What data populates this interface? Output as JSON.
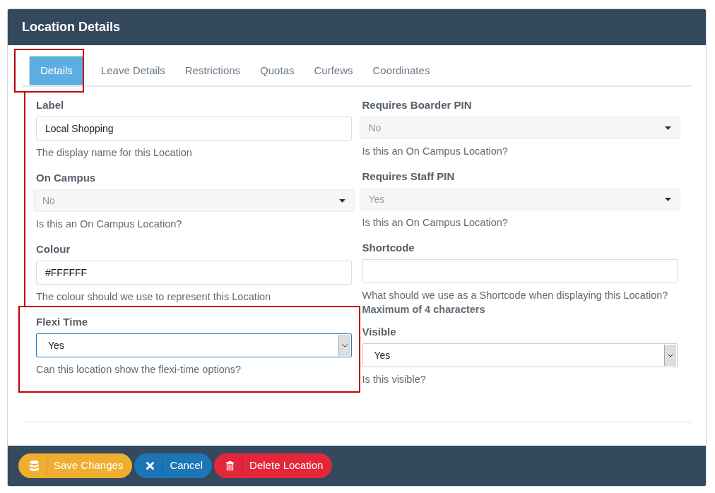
{
  "window": {
    "title": "Location Details"
  },
  "tabs": [
    {
      "label": "Details",
      "selected": true
    },
    {
      "label": "Leave Details",
      "selected": false
    },
    {
      "label": "Restrictions",
      "selected": false
    },
    {
      "label": "Quotas",
      "selected": false
    },
    {
      "label": "Curfews",
      "selected": false
    },
    {
      "label": "Coordinates",
      "selected": false
    }
  ],
  "columns": [
    [
      {
        "label": "Label",
        "kind": "text",
        "value": "Local Shopping",
        "help": "The display name for this Location"
      },
      {
        "label": "On Campus",
        "kind": "locked-select",
        "value": "No",
        "help": "Is this an On Campus Location?"
      },
      {
        "label": "Colour",
        "kind": "text",
        "value": "#FFFFFF",
        "help": "The colour should we use to represent this Location"
      },
      {
        "label": "Flexi Time",
        "kind": "select",
        "value": "Yes",
        "focused": true,
        "help": "Can this location show the flexi-time options?"
      }
    ],
    [
      {
        "label": "Requires Boarder PIN",
        "kind": "locked-select",
        "value": "No",
        "help": "Is this an On Campus Location?"
      },
      {
        "label": "Requires Staff PIN",
        "kind": "locked-select",
        "value": "Yes",
        "help": "Is this an On Campus Location?"
      },
      {
        "label": "Shortcode",
        "kind": "text",
        "help": "What should we use as a Shortcode when displaying this Location?",
        "note": "Maximum of 4 characters"
      },
      {
        "label": "Visible",
        "kind": "select",
        "value": "Yes",
        "focused": false,
        "help": "Is this visible?"
      }
    ]
  ],
  "buttons": [
    {
      "label": "Save Changes",
      "kind": "save"
    },
    {
      "label": "Cancel",
      "kind": "cancel"
    },
    {
      "label": "Delete Location",
      "kind": "delete"
    }
  ]
}
